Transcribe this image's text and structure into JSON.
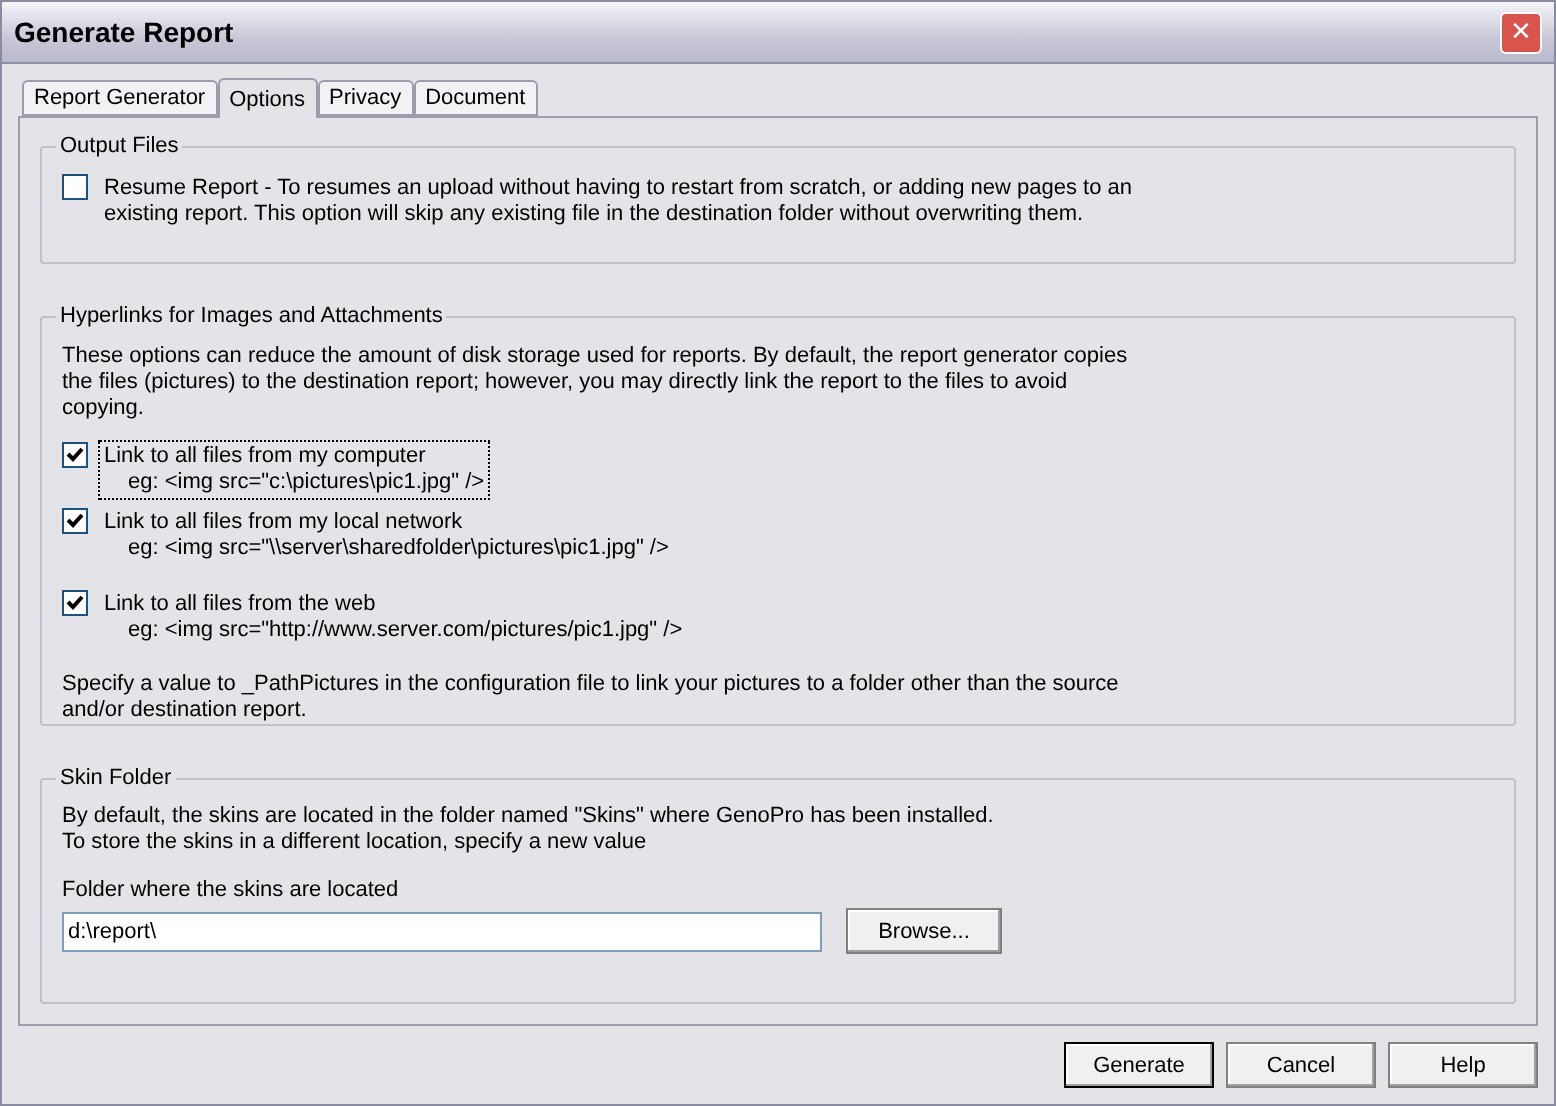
{
  "window": {
    "title": "Generate Report",
    "close": "✕"
  },
  "tabs": [
    {
      "label": "Report Generator",
      "selected": false
    },
    {
      "label": "Options",
      "selected": true
    },
    {
      "label": "Privacy",
      "selected": false
    },
    {
      "label": "Document",
      "selected": false
    }
  ],
  "output_files": {
    "title": "Output Files",
    "option": {
      "label": "Resume Report - To resumes an upload without having to restart from scratch, or adding new pages to an existing report. This option will skip any existing file in the destination folder without overwriting them.",
      "checked": false
    }
  },
  "hyperlinks": {
    "title": "Hyperlinks for Images and Attachments",
    "intro": "These options can reduce the amount of disk storage used for reports.  By default, the report generator copies the files (pictures) to the destination report; however, you may directly link the report to the files to avoid copying.",
    "options": [
      {
        "label": "Link to all files from my computer",
        "example": "eg: <img src=\"c:\\pictures\\pic1.jpg\" />",
        "checked": true,
        "focused": true
      },
      {
        "label": "Link to all files from my local network",
        "example": "eg: <img src=\"\\\\server\\sharedfolder\\pictures\\pic1.jpg\" />",
        "checked": true,
        "focused": false
      },
      {
        "label": "Link to all files from the web",
        "example": "eg: <img src=\"http://www.server.com/pictures/pic1.jpg\" />",
        "checked": true,
        "focused": false
      }
    ],
    "note": "Specify a value to _PathPictures in the configuration file to link your pictures to a folder other than the source and/or destination report."
  },
  "skin_folder": {
    "title": "Skin Folder",
    "intro_lines": [
      "By default, the skins are located in the folder named \"Skins\" where GenoPro has been installed.",
      "To store the skins in a different location, specify a new value"
    ],
    "field_label": "Folder where the skins are located",
    "value": "d:\\report\\",
    "browse": "Browse..."
  },
  "buttons": [
    {
      "label": "Generate",
      "default": true
    },
    {
      "label": "Cancel",
      "default": false
    },
    {
      "label": "Help",
      "default": false
    }
  ]
}
